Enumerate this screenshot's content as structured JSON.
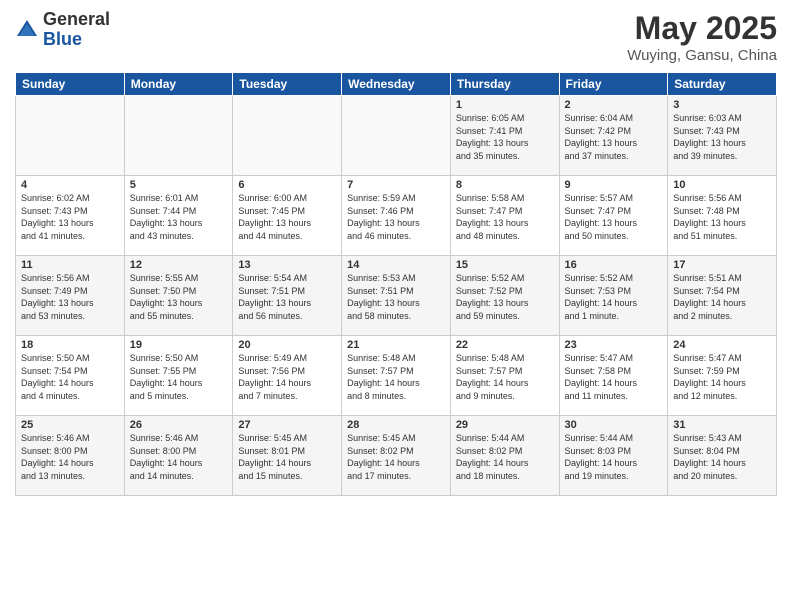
{
  "logo": {
    "general": "General",
    "blue": "Blue"
  },
  "title": "May 2025",
  "location": "Wuying, Gansu, China",
  "weekdays": [
    "Sunday",
    "Monday",
    "Tuesday",
    "Wednesday",
    "Thursday",
    "Friday",
    "Saturday"
  ],
  "weeks": [
    [
      {
        "day": "",
        "info": ""
      },
      {
        "day": "",
        "info": ""
      },
      {
        "day": "",
        "info": ""
      },
      {
        "day": "",
        "info": ""
      },
      {
        "day": "1",
        "info": "Sunrise: 6:05 AM\nSunset: 7:41 PM\nDaylight: 13 hours\nand 35 minutes."
      },
      {
        "day": "2",
        "info": "Sunrise: 6:04 AM\nSunset: 7:42 PM\nDaylight: 13 hours\nand 37 minutes."
      },
      {
        "day": "3",
        "info": "Sunrise: 6:03 AM\nSunset: 7:43 PM\nDaylight: 13 hours\nand 39 minutes."
      }
    ],
    [
      {
        "day": "4",
        "info": "Sunrise: 6:02 AM\nSunset: 7:43 PM\nDaylight: 13 hours\nand 41 minutes."
      },
      {
        "day": "5",
        "info": "Sunrise: 6:01 AM\nSunset: 7:44 PM\nDaylight: 13 hours\nand 43 minutes."
      },
      {
        "day": "6",
        "info": "Sunrise: 6:00 AM\nSunset: 7:45 PM\nDaylight: 13 hours\nand 44 minutes."
      },
      {
        "day": "7",
        "info": "Sunrise: 5:59 AM\nSunset: 7:46 PM\nDaylight: 13 hours\nand 46 minutes."
      },
      {
        "day": "8",
        "info": "Sunrise: 5:58 AM\nSunset: 7:47 PM\nDaylight: 13 hours\nand 48 minutes."
      },
      {
        "day": "9",
        "info": "Sunrise: 5:57 AM\nSunset: 7:47 PM\nDaylight: 13 hours\nand 50 minutes."
      },
      {
        "day": "10",
        "info": "Sunrise: 5:56 AM\nSunset: 7:48 PM\nDaylight: 13 hours\nand 51 minutes."
      }
    ],
    [
      {
        "day": "11",
        "info": "Sunrise: 5:56 AM\nSunset: 7:49 PM\nDaylight: 13 hours\nand 53 minutes."
      },
      {
        "day": "12",
        "info": "Sunrise: 5:55 AM\nSunset: 7:50 PM\nDaylight: 13 hours\nand 55 minutes."
      },
      {
        "day": "13",
        "info": "Sunrise: 5:54 AM\nSunset: 7:51 PM\nDaylight: 13 hours\nand 56 minutes."
      },
      {
        "day": "14",
        "info": "Sunrise: 5:53 AM\nSunset: 7:51 PM\nDaylight: 13 hours\nand 58 minutes."
      },
      {
        "day": "15",
        "info": "Sunrise: 5:52 AM\nSunset: 7:52 PM\nDaylight: 13 hours\nand 59 minutes."
      },
      {
        "day": "16",
        "info": "Sunrise: 5:52 AM\nSunset: 7:53 PM\nDaylight: 14 hours\nand 1 minute."
      },
      {
        "day": "17",
        "info": "Sunrise: 5:51 AM\nSunset: 7:54 PM\nDaylight: 14 hours\nand 2 minutes."
      }
    ],
    [
      {
        "day": "18",
        "info": "Sunrise: 5:50 AM\nSunset: 7:54 PM\nDaylight: 14 hours\nand 4 minutes."
      },
      {
        "day": "19",
        "info": "Sunrise: 5:50 AM\nSunset: 7:55 PM\nDaylight: 14 hours\nand 5 minutes."
      },
      {
        "day": "20",
        "info": "Sunrise: 5:49 AM\nSunset: 7:56 PM\nDaylight: 14 hours\nand 7 minutes."
      },
      {
        "day": "21",
        "info": "Sunrise: 5:48 AM\nSunset: 7:57 PM\nDaylight: 14 hours\nand 8 minutes."
      },
      {
        "day": "22",
        "info": "Sunrise: 5:48 AM\nSunset: 7:57 PM\nDaylight: 14 hours\nand 9 minutes."
      },
      {
        "day": "23",
        "info": "Sunrise: 5:47 AM\nSunset: 7:58 PM\nDaylight: 14 hours\nand 11 minutes."
      },
      {
        "day": "24",
        "info": "Sunrise: 5:47 AM\nSunset: 7:59 PM\nDaylight: 14 hours\nand 12 minutes."
      }
    ],
    [
      {
        "day": "25",
        "info": "Sunrise: 5:46 AM\nSunset: 8:00 PM\nDaylight: 14 hours\nand 13 minutes."
      },
      {
        "day": "26",
        "info": "Sunrise: 5:46 AM\nSunset: 8:00 PM\nDaylight: 14 hours\nand 14 minutes."
      },
      {
        "day": "27",
        "info": "Sunrise: 5:45 AM\nSunset: 8:01 PM\nDaylight: 14 hours\nand 15 minutes."
      },
      {
        "day": "28",
        "info": "Sunrise: 5:45 AM\nSunset: 8:02 PM\nDaylight: 14 hours\nand 17 minutes."
      },
      {
        "day": "29",
        "info": "Sunrise: 5:44 AM\nSunset: 8:02 PM\nDaylight: 14 hours\nand 18 minutes."
      },
      {
        "day": "30",
        "info": "Sunrise: 5:44 AM\nSunset: 8:03 PM\nDaylight: 14 hours\nand 19 minutes."
      },
      {
        "day": "31",
        "info": "Sunrise: 5:43 AM\nSunset: 8:04 PM\nDaylight: 14 hours\nand 20 minutes."
      }
    ]
  ]
}
